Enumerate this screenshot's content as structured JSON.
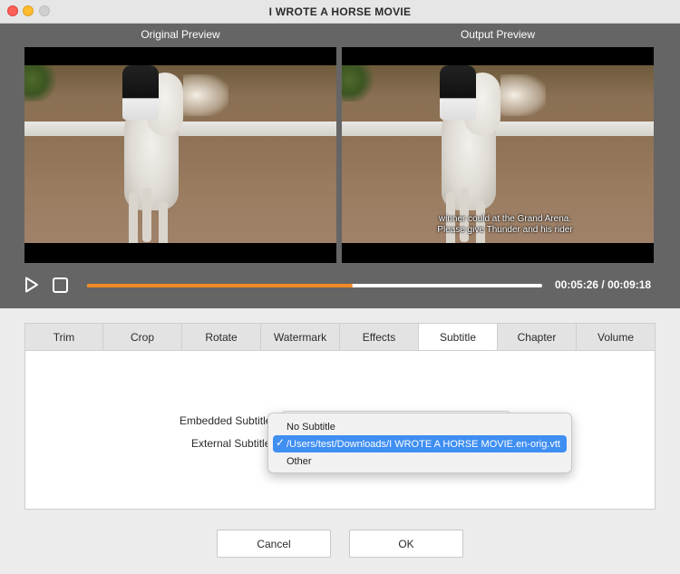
{
  "window": {
    "title": "I WROTE A HORSE MOVIE"
  },
  "preview": {
    "original_label": "Original Preview",
    "output_label": "Output Preview",
    "subtitle_line1": "winner could at the Grand Arena.",
    "subtitle_line2": "Please give Thunder and his rider"
  },
  "player": {
    "current_time": "00:05:26",
    "separator": " / ",
    "total_time": "00:09:18",
    "progress_percent": 58.4,
    "accent_color": "#f08a24"
  },
  "tabs": [
    {
      "label": "Trim",
      "active": false
    },
    {
      "label": "Crop",
      "active": false
    },
    {
      "label": "Rotate",
      "active": false
    },
    {
      "label": "Watermark",
      "active": false
    },
    {
      "label": "Effects",
      "active": false
    },
    {
      "label": "Subtitle",
      "active": true
    },
    {
      "label": "Chapter",
      "active": false
    },
    {
      "label": "Volume",
      "active": false
    }
  ],
  "subtitle_panel": {
    "embedded_label": "Embedded Subtitle",
    "external_label": "External Subtitle"
  },
  "dropdown": {
    "options": [
      {
        "label": "No Subtitle",
        "selected": false
      },
      {
        "label": "/Users/test/Downloads/I WROTE A HORSE MOVIE.en-orig.vtt",
        "selected": true
      },
      {
        "label": "Other",
        "selected": false
      }
    ],
    "check_glyph": "✓",
    "selection_color": "#3f8ef2"
  },
  "buttons": {
    "cancel_label": "Cancel",
    "ok_label": "OK"
  }
}
